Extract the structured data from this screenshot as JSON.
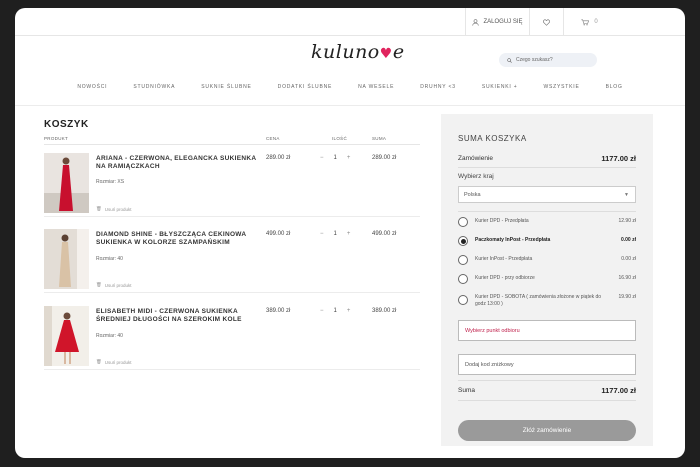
{
  "topbar": {
    "login": "ZALOGUJ SIĘ",
    "cart_count": "0"
  },
  "logo": {
    "text": "kuluno",
    "accent": "#e0245e"
  },
  "search": {
    "placeholder": "Czego szukasz?"
  },
  "nav": [
    "NOWOŚCI",
    "STUDNIÓWKA",
    "SUKNIE ŚLUBNE",
    "DODATKI ŚLUBNE",
    "NA WESELE",
    "DRUHNY <3",
    "SUKIENKI +",
    "WSZYSTKIE",
    "BLOG"
  ],
  "cart": {
    "title": "KOSZYK",
    "headers": {
      "product": "PRODUKT",
      "price": "CENA",
      "qty": "ILOŚĆ",
      "sum": "SUMA"
    },
    "remove_label": "Usuń produkt",
    "items": [
      {
        "name": "ARIANA - CZERWONA, ELEGANCKA SUKIENKA NA RAMIĄCZKACH",
        "size": "Rozmiar: XS",
        "price": "289.00 zł",
        "qty": "1",
        "sum": "289.00 zł",
        "color": "#c8102e"
      },
      {
        "name": "DIAMOND SHINE - BŁYSZCZĄCA CEKINOWA SUKIENKA W KOLORZE SZAMPAŃSKIM",
        "size": "Rozmiar: 40",
        "price": "499.00 zł",
        "qty": "1",
        "sum": "499.00 zł",
        "color": "#d9c2a6"
      },
      {
        "name": "ELISABETH MIDI - CZERWONA SUKIENKA ŚREDNIEJ DŁUGOŚCI NA SZEROKIM KOLE",
        "size": "Rozmiar: 40",
        "price": "389.00 zł",
        "qty": "1",
        "sum": "389.00 zł",
        "color": "#d0152a"
      }
    ]
  },
  "summary": {
    "title": "SUMA KOSZYKA",
    "order_label": "Zamówienie",
    "order_value": "1177.00 zł",
    "country_label": "Wybierz kraj",
    "country_value": "Polska",
    "shipping": [
      {
        "label": "Kurier DPD - Przedpłata",
        "price": "12.90 zł",
        "selected": false
      },
      {
        "label": "Paczkomaty InPost - Przedpłata",
        "price": "0.00 zł",
        "selected": true
      },
      {
        "label": "Kurier InPost - Przedpłata",
        "price": "0.00 zł",
        "selected": false
      },
      {
        "label": "Kurier DPD - przy odbiorze",
        "price": "16.90 zł",
        "selected": false
      },
      {
        "label": "Kurier DPD - SOBOTA ( zamówienia złożone w piątek do godz 13:00 )",
        "price": "19.90 zł",
        "selected": false
      }
    ],
    "pickup_label": "Wybierz punkt odbioru",
    "coupon_label": "Dodaj kod zniżkowy",
    "total_label": "Suma",
    "total_value": "1177.00 zł",
    "order_button": "Złóż zamówienie"
  }
}
